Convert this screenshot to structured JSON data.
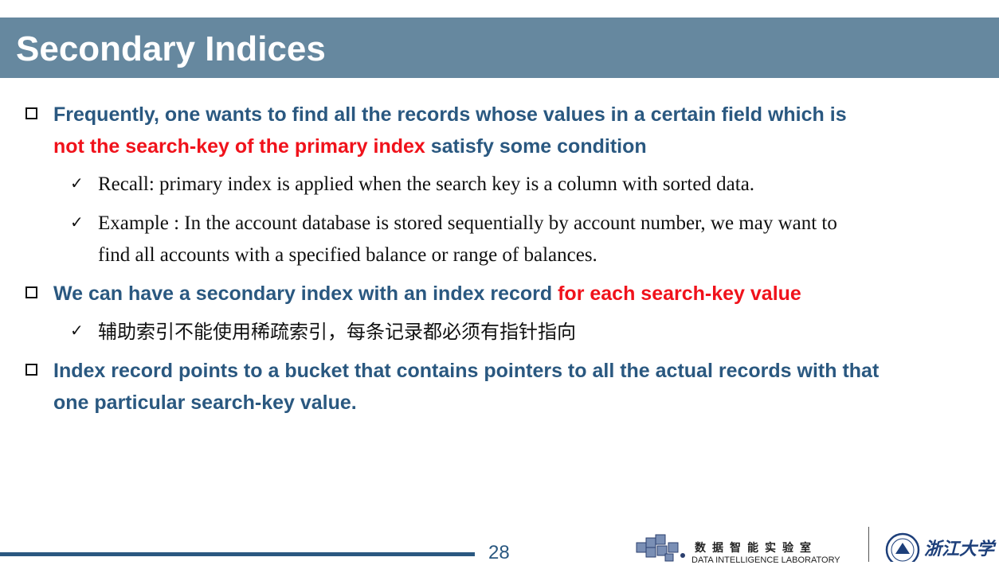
{
  "slide": {
    "title": "Secondary Indices",
    "page_number": "28"
  },
  "bullets": {
    "b1": {
      "line1": "Frequently, one wants to find all the records whose values in a certain field which is",
      "line2_red": "not the search-key of the primary index",
      "line2_rest": " satisfy some condition"
    },
    "s1": {
      "text": "Recall: primary index is applied when the search key is a column with sorted data."
    },
    "s2": {
      "line1": "Example : In the account database is stored sequentially by account number, we may want to",
      "line2": "find all accounts with a specified balance or range of balances."
    },
    "b2": {
      "text": "We can have a secondary index with an index record ",
      "red": "for each search-key value"
    },
    "s3": {
      "text": "辅助索引不能使用稀疏索引，每条记录都必须有指针指向"
    },
    "b3": {
      "line1": "Index record points to a bucket that contains pointers to all the actual records with that",
      "line2": "one particular search-key value."
    }
  },
  "footer": {
    "lab_name_cn": "数据智能实验室",
    "lab_name_en": "DATA INTELLIGENCE LABORATORY",
    "university_name": "浙江大学"
  },
  "colors": {
    "title_bar": "#66889f",
    "bullet_text": "#2a5880",
    "highlight": "#f0121b"
  }
}
